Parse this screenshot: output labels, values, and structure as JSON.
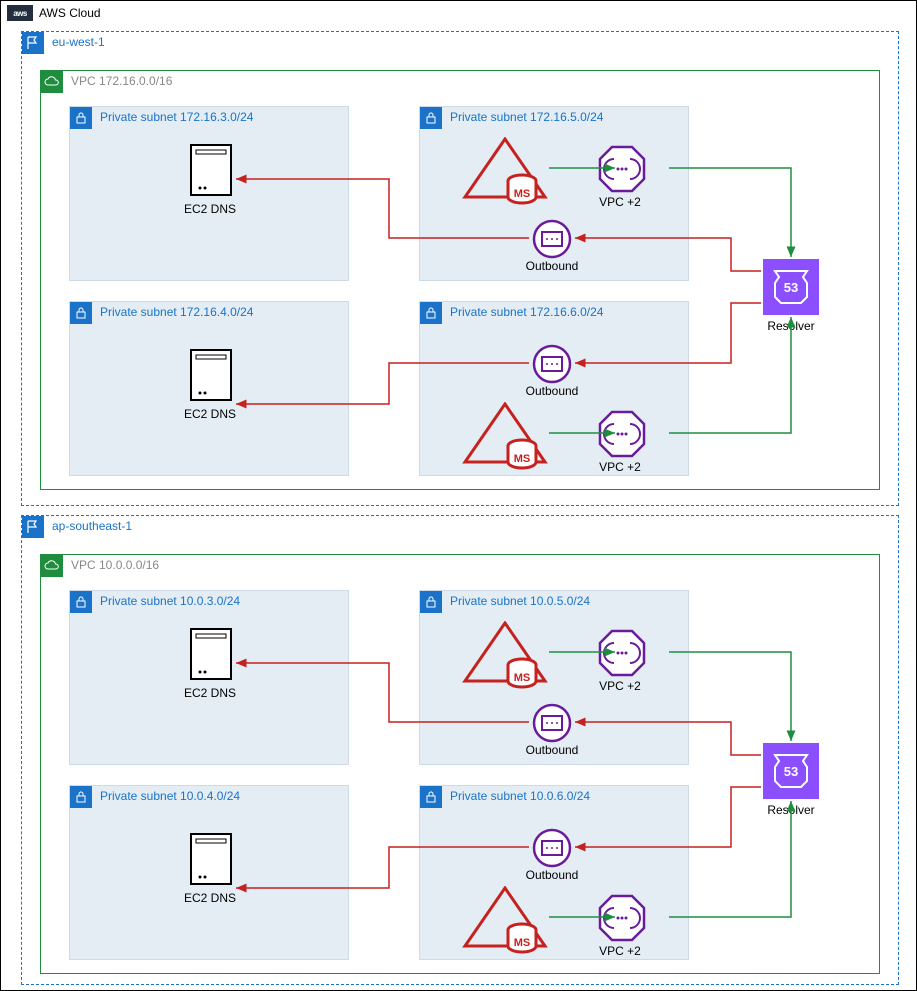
{
  "cloud": {
    "label": "AWS Cloud"
  },
  "regions": [
    {
      "id": "r1",
      "label": "eu-west-1",
      "vpc": {
        "label": "VPC 172.16.0.0/16"
      },
      "subnets": {
        "s1": {
          "label": "Private subnet 172.16.3.0/24",
          "node": "EC2 DNS"
        },
        "s2": {
          "label": "Private subnet 172.16.4.0/24",
          "node": "EC2 DNS"
        },
        "s3": {
          "label": "Private subnet 172.16.5.0/24",
          "vpc2": "VPC +2",
          "outbound": "Outbound"
        },
        "s4": {
          "label": "Private subnet 172.16.6.0/24",
          "vpc2": "VPC +2",
          "outbound": "Outbound"
        }
      },
      "resolver": "Resolver"
    },
    {
      "id": "r2",
      "label": "ap-southeast-1",
      "vpc": {
        "label": "VPC 10.0.0.0/16"
      },
      "subnets": {
        "s1": {
          "label": "Private subnet 10.0.3.0/24",
          "node": "EC2 DNS"
        },
        "s2": {
          "label": "Private subnet 10.0.4.0/24",
          "node": "EC2 DNS"
        },
        "s3": {
          "label": "Private subnet 10.0.5.0/24",
          "vpc2": "VPC +2",
          "outbound": "Outbound"
        },
        "s4": {
          "label": "Private subnet 10.0.6.0/24",
          "vpc2": "VPC +2",
          "outbound": "Outbound"
        }
      },
      "resolver": "Resolver"
    }
  ]
}
